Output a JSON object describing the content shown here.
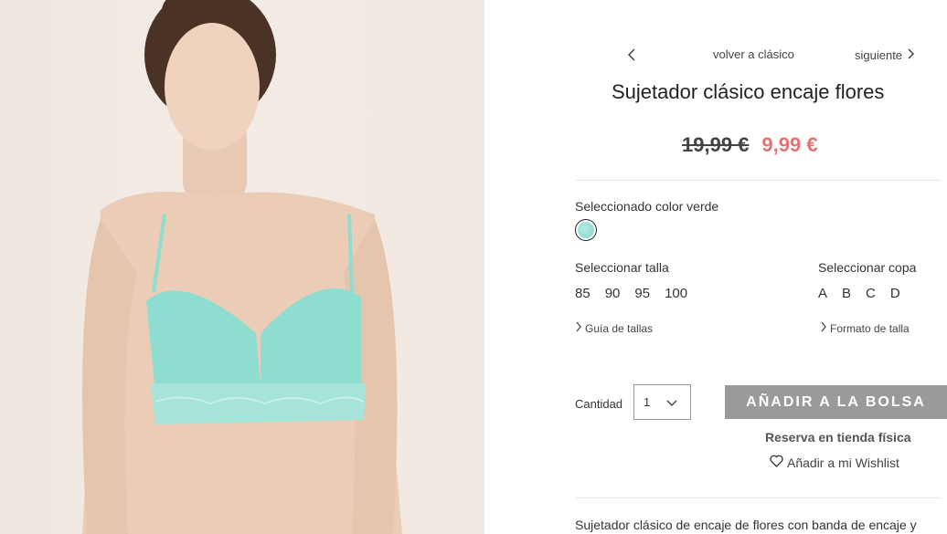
{
  "product": {
    "image_alt": "Sujetador clásico encaje flores verde",
    "title": "Sujetador clásico encaje flores",
    "price_old": "19,99 €",
    "price_new": "9,99 €",
    "description": "Sujetador clásico de encaje de flores con banda de encaje y"
  },
  "nav": {
    "back_label": "volver a clásico",
    "next_label": "siguiente",
    "prev_icon": "chevron-left-icon",
    "next_icon": "chevron-right-icon"
  },
  "color": {
    "label": "Seleccionado color verde",
    "swatch_color": "#8fdcd0"
  },
  "size": {
    "label": "Seleccionar talla",
    "options": [
      "85",
      "90",
      "95",
      "100"
    ],
    "guide_link": "Guía de tallas"
  },
  "cup": {
    "label": "Seleccionar copa",
    "options": [
      "A",
      "B",
      "C",
      "D"
    ],
    "format_link": "Formato de talla"
  },
  "purchase": {
    "quantity_label": "Cantidad",
    "quantity_value": "1",
    "add_button": "AÑADIR A LA BOLSA",
    "reserve_link": "Reserva en tienda física",
    "wishlist_link": "Añadir a mi Wishlist"
  },
  "colors": {
    "price_sale": "#e57373",
    "button_bg": "#9a9a9a"
  }
}
